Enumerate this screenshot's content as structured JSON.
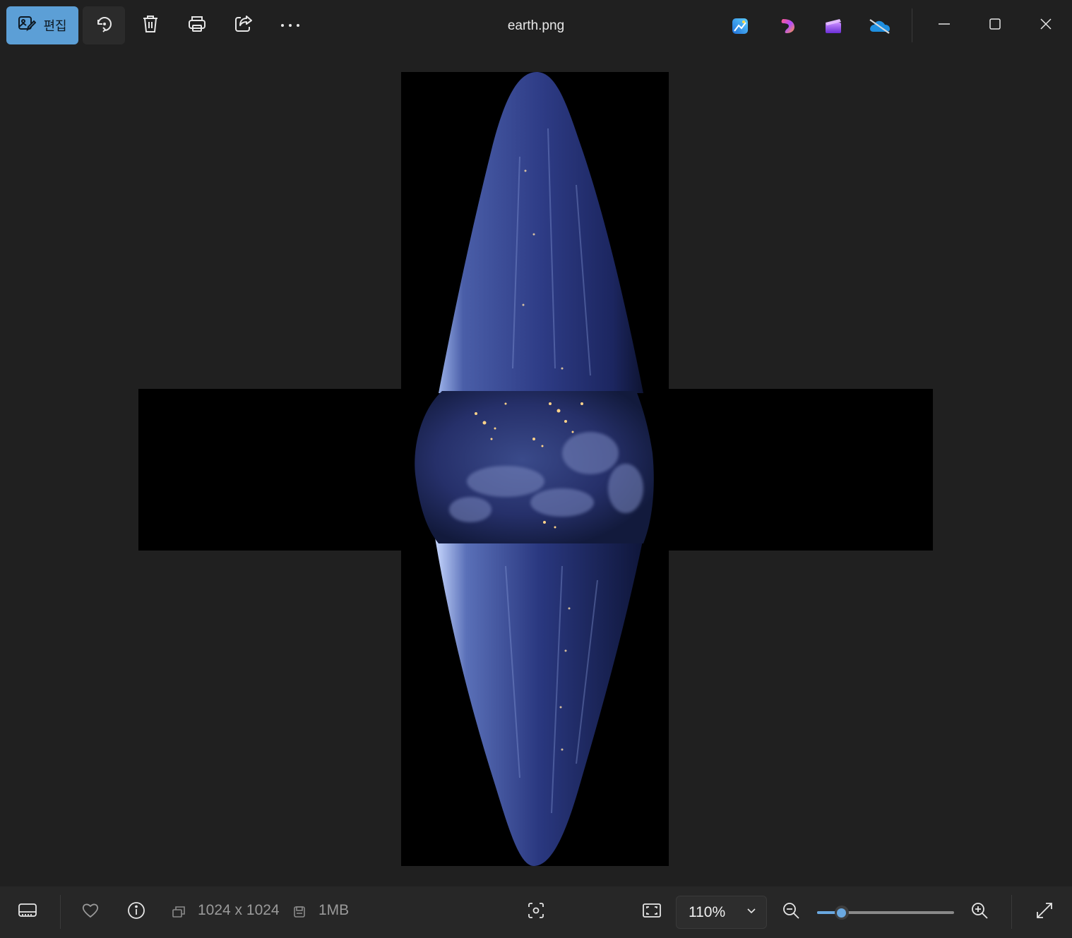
{
  "toolbar": {
    "edit_label": "편집",
    "tools": [
      "rotate-icon",
      "trash-icon",
      "print-icon",
      "share-icon",
      "more-icon"
    ]
  },
  "window": {
    "title": "earth.png",
    "app_icons": [
      "photos-app-icon",
      "copilot-app-icon",
      "clipchamp-app-icon",
      "onedrive-icon"
    ]
  },
  "viewer": {
    "image_alt": "Distorted earth-at-night render on a cross-shaped black background"
  },
  "status": {
    "dimensions": "1024 x 1024",
    "file_size": "1MB",
    "zoom_value": "110%",
    "zoom_slider_fraction": 0.18
  },
  "colors": {
    "accent": "#5c9fd6",
    "background": "#202020",
    "bottombar": "#272727",
    "slider_accent": "#6aa8e0"
  }
}
